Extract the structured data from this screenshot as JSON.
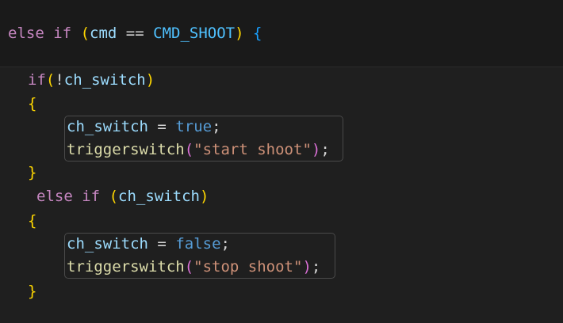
{
  "colors": {
    "background": "#1f1f1f",
    "keyword": "#c586c0",
    "variable": "#9cdcfe",
    "constant": "#4fc1ff",
    "function": "#dcdcaa",
    "string": "#ce9178",
    "boolean": "#569cd6",
    "bracket_level_1": "#ffd700",
    "bracket_level_2": "#da70d6",
    "bracket_level_3": "#179fff"
  },
  "code": {
    "line1": {
      "kw_else": "else",
      "kw_if": "if",
      "paren_open": "(",
      "var_cmd": "cmd",
      "op_eq": "==",
      "const_shoot": "CMD_SHOOT",
      "paren_close": ")",
      "brace_open": "{"
    },
    "line2": {
      "kw_if": "if",
      "paren_open": "(",
      "op_not": "!",
      "var": "ch_switch",
      "paren_close": ")"
    },
    "line3": {
      "brace_open": "{"
    },
    "line4": {
      "var": "ch_switch",
      "op_assign": "=",
      "value": "true",
      "semi": ";"
    },
    "line5": {
      "fn": "triggerswitch",
      "paren_open": "(",
      "str": "\"start shoot\"",
      "paren_close": ")",
      "semi": ";"
    },
    "line6": {
      "brace_close": "}"
    },
    "line7": {
      "kw_else": "else",
      "kw_if": "if",
      "paren_open": "(",
      "var": "ch_switch",
      "paren_close": ")"
    },
    "line8": {
      "brace_open": "{"
    },
    "line9": {
      "var": "ch_switch",
      "op_assign": "=",
      "value": "false",
      "semi": ";"
    },
    "line10": {
      "fn": "triggerswitch",
      "paren_open": "(",
      "str": "\"stop shoot\"",
      "paren_close": ")",
      "semi": ";"
    },
    "line11": {
      "brace_close": "}"
    }
  }
}
